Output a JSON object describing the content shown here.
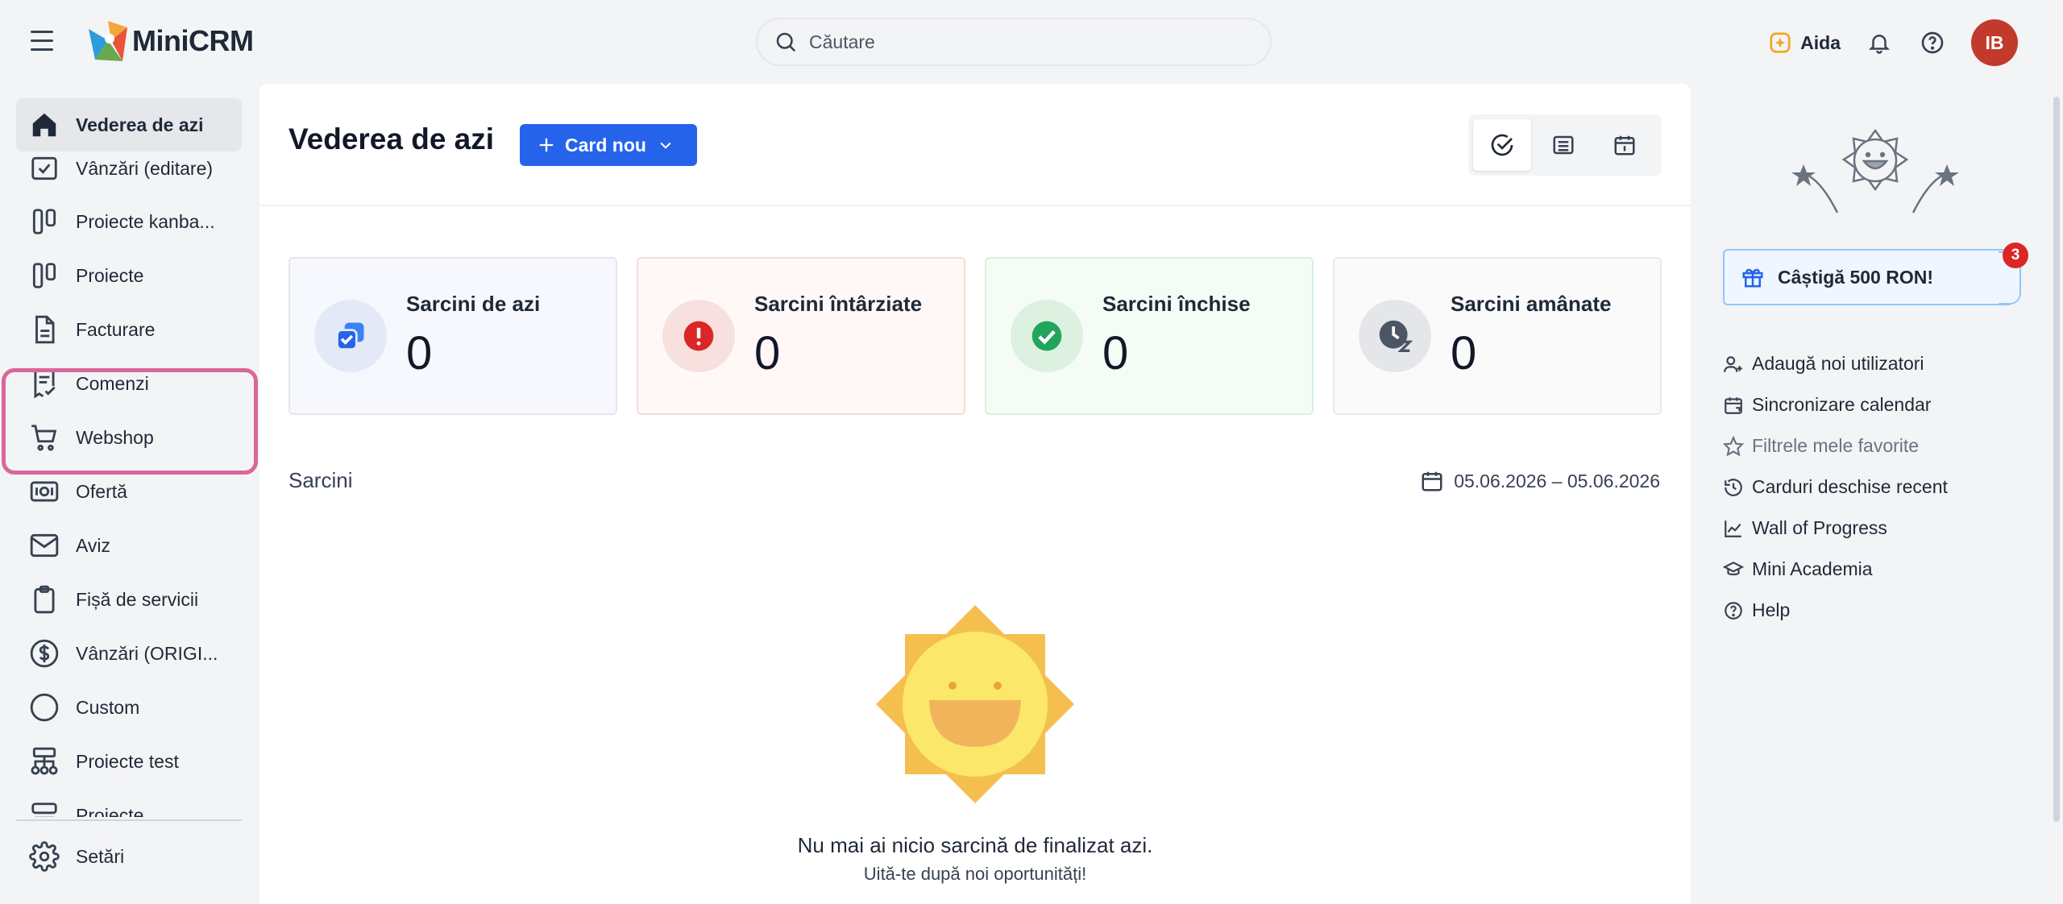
{
  "app": {
    "name": "MiniCRM"
  },
  "search": {
    "placeholder": "Căutare"
  },
  "header": {
    "assistant_label": "Aida",
    "avatar_initials": "IB"
  },
  "sidebar": {
    "items": [
      {
        "label": "Vederea de azi",
        "icon": "home-icon",
        "active": true
      },
      {
        "label": "Vânzări (editare)",
        "icon": "checkbox-icon"
      },
      {
        "label": "Proiecte kanba...",
        "icon": "kanban-icon"
      },
      {
        "label": "Proiecte",
        "icon": "kanban-icon"
      },
      {
        "label": "Facturare",
        "icon": "document-icon"
      },
      {
        "label": "Comenzi",
        "icon": "receipt-icon"
      },
      {
        "label": "Webshop",
        "icon": "cart-icon"
      },
      {
        "label": "Ofertă",
        "icon": "banknote-icon"
      },
      {
        "label": "Aviz",
        "icon": "envelope-icon"
      },
      {
        "label": "Fișă de servicii",
        "icon": "clipboard-icon"
      },
      {
        "label": "Vânzări (ORIGI...",
        "icon": "dollar-circle-icon"
      },
      {
        "label": "Custom",
        "icon": "circle-icon"
      },
      {
        "label": "Proiecte test",
        "icon": "hierarchy-icon"
      },
      {
        "label": "Proiecte",
        "icon": "server-icon"
      }
    ],
    "settings_label": "Setări"
  },
  "main": {
    "title": "Vederea de azi",
    "new_card_label": "Card nou",
    "stats": [
      {
        "label": "Sarcini de azi",
        "value": "0",
        "color": "#2563eb"
      },
      {
        "label": "Sarcini întârziate",
        "value": "0",
        "color": "#dc2626"
      },
      {
        "label": "Sarcini închise",
        "value": "0",
        "color": "#22a55b"
      },
      {
        "label": "Sarcini amânate",
        "value": "0",
        "color": "#4b5563"
      }
    ],
    "section_label": "Sarcini",
    "date_range": "05.06.2026 – 05.06.2026",
    "empty_title": "Nu mai ai nicio sarcină de finalizat azi.",
    "empty_subtitle": "Uită-te după noi oportunități!"
  },
  "right_panel": {
    "promo_label": "Câștigă 500 RON!",
    "promo_badge": "3",
    "links": [
      {
        "label": "Adaugă noi utilizatori",
        "icon": "add-user-icon"
      },
      {
        "label": "Sincronizare calendar",
        "icon": "calendar-sync-icon"
      },
      {
        "label": "Filtrele mele favorite",
        "icon": "star-icon",
        "muted": true
      },
      {
        "label": "Carduri deschise recent",
        "icon": "history-icon"
      },
      {
        "label": "Wall of Progress",
        "icon": "chart-line-icon"
      },
      {
        "label": "Mini Academia",
        "icon": "graduation-cap-icon"
      },
      {
        "label": "Help",
        "icon": "help-circle-icon"
      }
    ]
  },
  "colors": {
    "primary": "#2563eb",
    "avatar": "#c23a2b",
    "highlight": "#d9679a",
    "badge": "#dc2626"
  }
}
